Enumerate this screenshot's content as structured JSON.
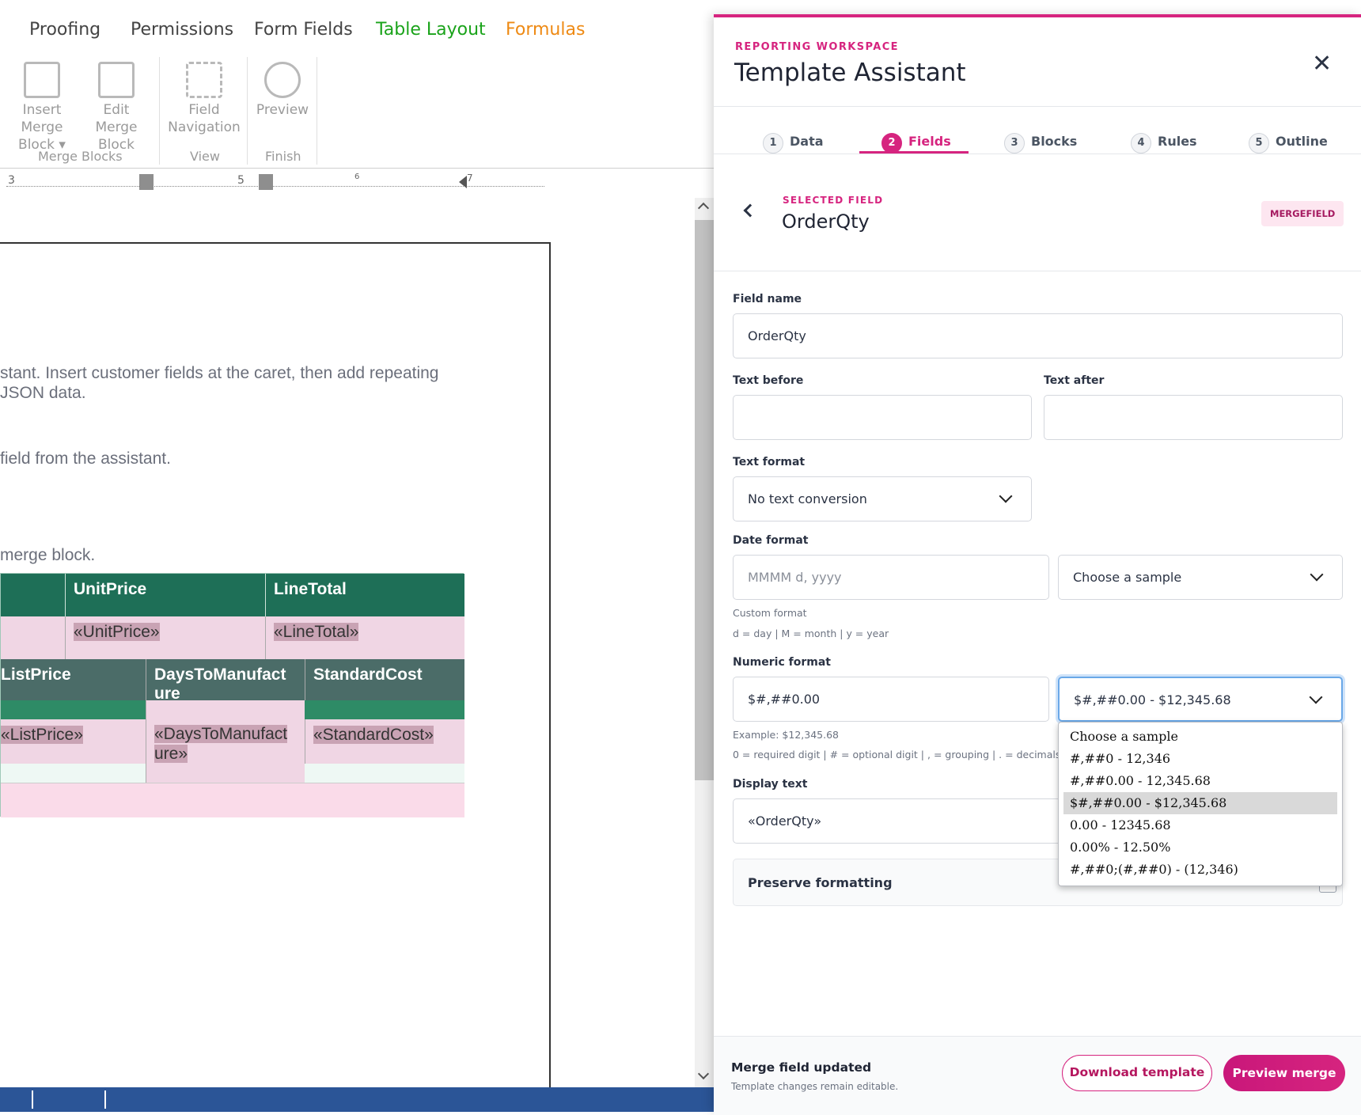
{
  "ribbon": {
    "tabs": [
      "Proofing",
      "Permissions",
      "Form Fields",
      "Table Layout",
      "Formulas"
    ],
    "buttons": {
      "insert_merge_block": "Insert Merge\nBlock ▾",
      "insert_l1": "Insert Merge",
      "insert_l2": "Block ▾",
      "edit_l1": "Edit Merge",
      "edit_l2": "Block",
      "nav_l1": "Field",
      "nav_l2": "Navigation",
      "preview": "Preview"
    },
    "groups": [
      "Merge Blocks",
      "View",
      "Finish"
    ],
    "tab_colors": {
      "table_layout": "#1aa31a",
      "formulas": "#ee8a14"
    }
  },
  "ruler": {
    "marks": [
      "3",
      "5",
      "6",
      "7"
    ]
  },
  "document": {
    "line1": "stant. Insert customer fields at the caret, then add repeating",
    "line2": " JSON data.",
    "line3": "field from the assistant.",
    "line4": "merge block.",
    "table": {
      "h_unitprice": "UnitPrice",
      "h_linetotal": "LineTotal",
      "f_unitprice": "«UnitPrice»",
      "f_linetotal": "«LineTotal»",
      "h_listprice": "ListPrice",
      "h_days1": "DaysToManufact",
      "h_days2": "ure",
      "h_standardcost": "StandardCost",
      "f_listprice": "«ListPrice»",
      "f_days1": "«DaysToManufact",
      "f_days2": "ure»",
      "f_standardcost": "«StandardCost»"
    }
  },
  "panel": {
    "eyebrow": "REPORTING WORKSPACE",
    "title": "Template Assistant",
    "steps": [
      {
        "n": "1",
        "label": "Data"
      },
      {
        "n": "2",
        "label": "Fields"
      },
      {
        "n": "3",
        "label": "Blocks"
      },
      {
        "n": "4",
        "label": "Rules"
      },
      {
        "n": "5",
        "label": "Outline"
      }
    ],
    "active_step": "Fields",
    "selected_label": "SELECTED FIELD",
    "selected_name": "OrderQty",
    "badge": "MERGEFIELD",
    "field_name_label": "Field name",
    "field_name_value": "OrderQty",
    "text_before_label": "Text before",
    "text_after_label": "Text after",
    "text_format_label": "Text format",
    "text_format_value": "No text conversion",
    "date_format_label": "Date format",
    "date_format_placeholder": "MMMM d, yyyy",
    "date_sample_value": "Choose a sample",
    "date_hint1": "Custom format",
    "date_hint2": "d = day | M = month | y = year",
    "numeric_format_label": "Numeric format",
    "numeric_format_value": "$#,##0.00",
    "numeric_sample_value": "$#,##0.00 - $12,345.68",
    "numeric_hint1": "Example: $12,345.68",
    "numeric_hint2": "0 = required digit | # = optional digit | , = grouping | . = decimals",
    "display_text_label": "Display text",
    "display_text_value": "«OrderQty»",
    "preserve_label": "Preserve formatting",
    "dropdown_options": [
      "Choose a sample",
      "#,##0 - 12,346",
      "#,##0.00 - 12,345.68",
      "$#,##0.00 - $12,345.68",
      "0.00 - 12345.68",
      "0.00% - 12.50%",
      "#,##0;(#,##0) - (12,346)"
    ],
    "dropdown_selected": "$#,##0.00 - $12,345.68",
    "footer_title": "Merge field updated",
    "footer_sub": "Template changes remain editable.",
    "download_label": "Download template",
    "preview_label": "Preview merge",
    "accent": "#d6247f"
  }
}
